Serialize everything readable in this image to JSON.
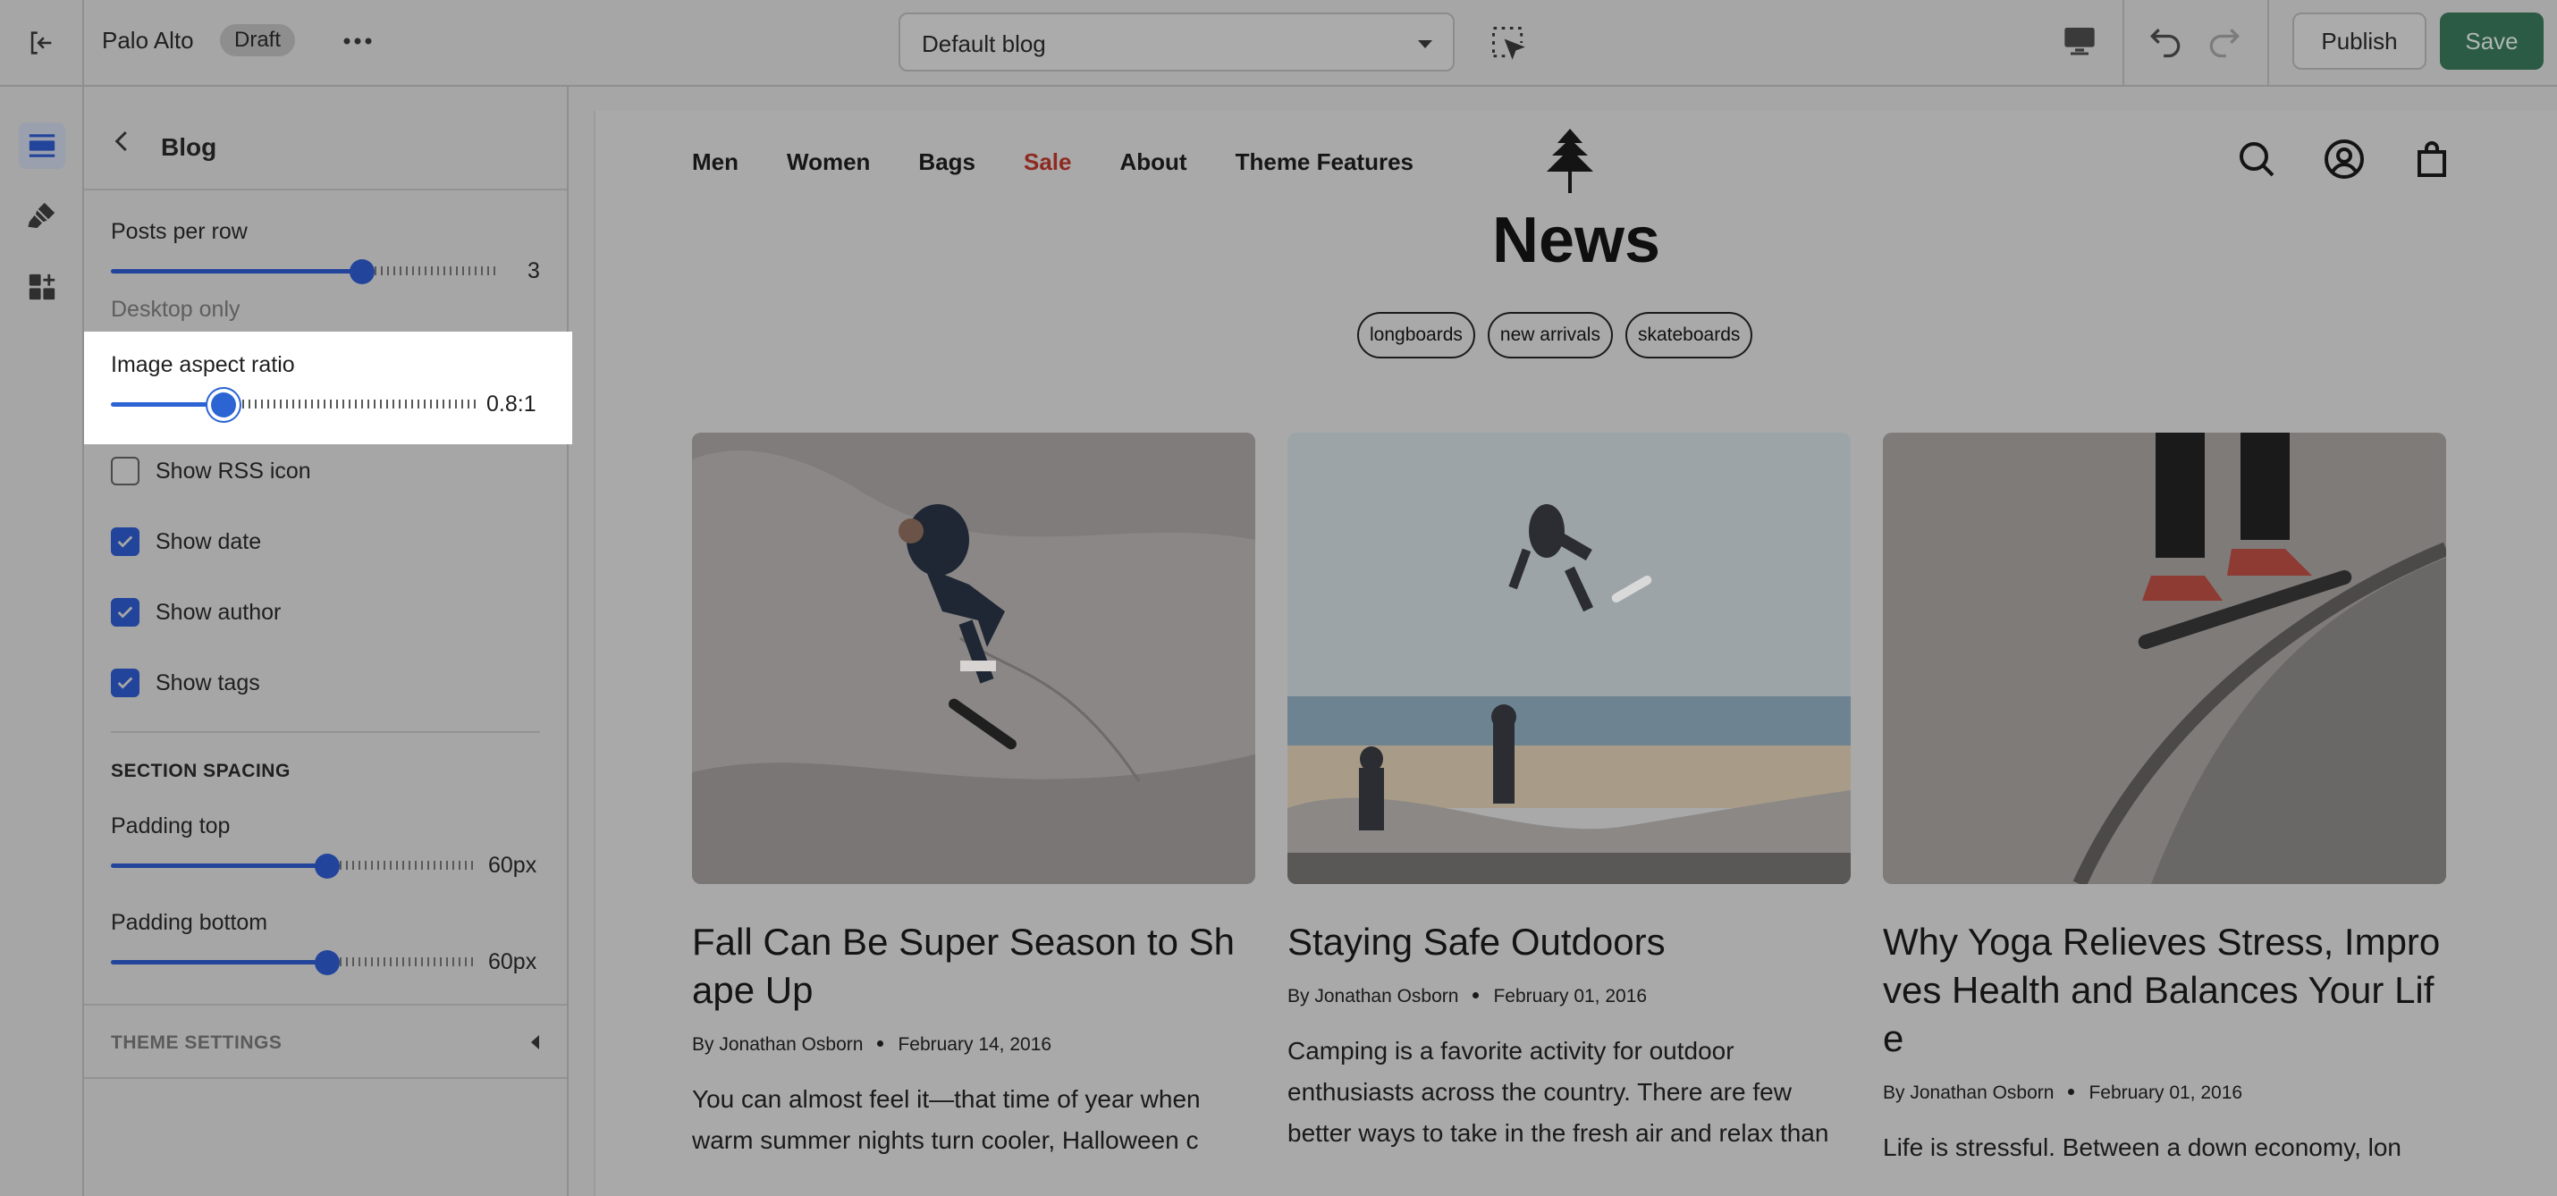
{
  "topbar": {
    "store_name": "Palo Alto",
    "status_badge": "Draft",
    "template_select": "Default blog",
    "publish_label": "Publish",
    "save_label": "Save"
  },
  "panel": {
    "title": "Blog",
    "posts_per_row": {
      "label": "Posts per row",
      "value": "3",
      "level": 0.65,
      "hint": "Desktop only"
    },
    "image_aspect_ratio": {
      "label": "Image aspect ratio",
      "value": "0.8:1",
      "level": 0.31
    },
    "checkboxes": [
      {
        "label": "Show RSS icon",
        "checked": false
      },
      {
        "label": "Show date",
        "checked": true
      },
      {
        "label": "Show author",
        "checked": true
      },
      {
        "label": "Show tags",
        "checked": true
      }
    ],
    "section_spacing": {
      "heading": "SECTION SPACING",
      "padding_top": {
        "label": "Padding top",
        "value": "60px",
        "level": 0.59
      },
      "padding_bottom": {
        "label": "Padding bottom",
        "value": "60px",
        "level": 0.59
      }
    },
    "theme_settings": "THEME SETTINGS"
  },
  "preview": {
    "nav": [
      "Men",
      "Women",
      "Bags",
      "Sale",
      "About",
      "Theme Features"
    ],
    "page_title": "News",
    "tags": [
      "longboards",
      "new arrivals",
      "skateboards"
    ],
    "posts": [
      {
        "title": "Fall Can Be Super Season to Shape Up",
        "author": "By Jonathan Osborn",
        "date": "February 14, 2016",
        "excerpt": "You can almost feel it—that time of year when warm summer nights turn cooler, Halloween c"
      },
      {
        "title": "Staying Safe Outdoors",
        "author": "By Jonathan Osborn",
        "date": "February 01, 2016",
        "excerpt": "Camping is a favorite activity for outdoor enthusiasts across the country. There are few better ways to take in the fresh air and relax than"
      },
      {
        "title": "Why Yoga Relieves Stress, Improves Health and Balances Your Life",
        "author": "By Jonathan Osborn",
        "date": "February 01, 2016",
        "excerpt": "Life is stressful. Between a down economy, lon"
      }
    ]
  },
  "colors": {
    "accent": "#22449b",
    "save_button": "#2b5b44",
    "sale_link": "#8e2a22",
    "overlay_gray": "#a6a6a6"
  }
}
